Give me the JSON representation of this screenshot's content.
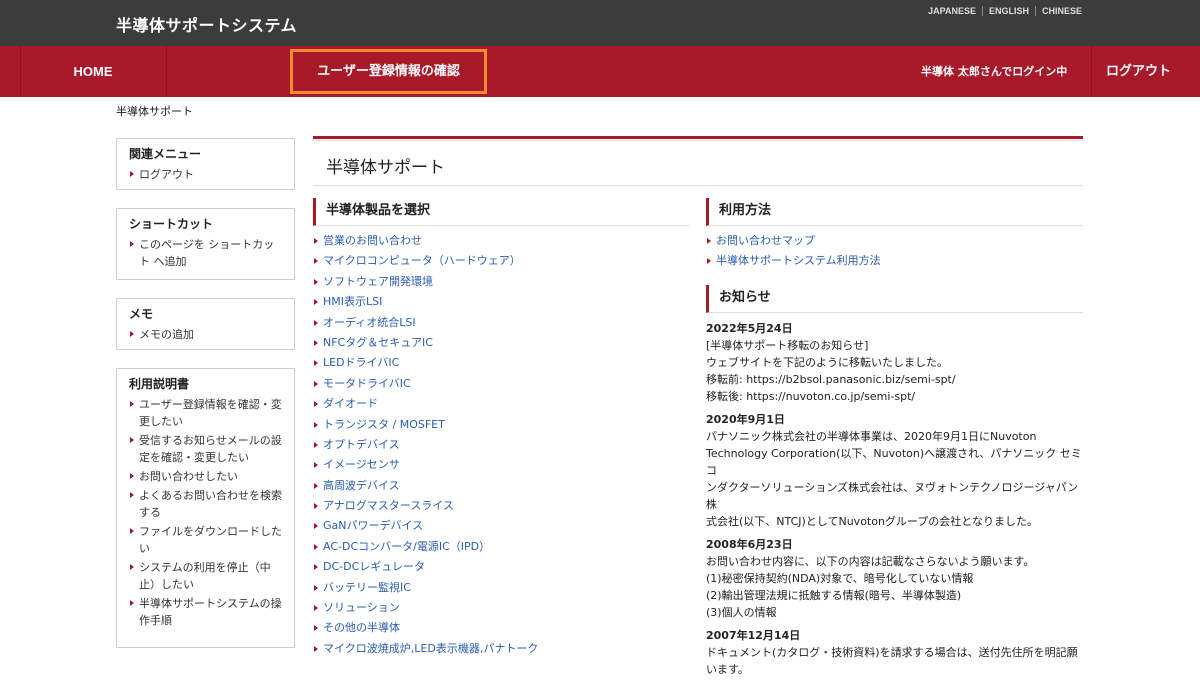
{
  "header": {
    "site_title": "半導体サポートシステム",
    "languages": [
      "JAPANESE",
      "ENGLISH",
      "CHINESE"
    ]
  },
  "nav": {
    "home": "HOME",
    "confirm": "ユーザー登録情報の確認",
    "login_message": "半導体 太郎さんでログイン中",
    "logout": "ログアウト"
  },
  "breadcrumb": "半導体サポート",
  "sidebar": {
    "related": {
      "title": "関連メニュー",
      "items": [
        "ログアウト"
      ]
    },
    "shortcut": {
      "title": "ショートカット",
      "items": [
        "このページを ショートカット へ追加"
      ]
    },
    "memo": {
      "title": "メモ",
      "items": [
        "メモの追加"
      ]
    },
    "manual": {
      "title": "利用説明書",
      "items": [
        "ユーザー登録情報を確認・変更したい",
        "受信するお知らせメールの設定を確認・変更したい",
        "お問い合わせしたい",
        "よくあるお問い合わせを検索する",
        "ファイルをダウンロードしたい",
        "システムの利用を停止（中止）したい",
        "半導体サポートシステムの操作手順"
      ]
    }
  },
  "main": {
    "page_title": "半導体サポート",
    "products": {
      "title": "半導体製品を選択",
      "items": [
        "営業のお問い合わせ",
        "マイクロコンピュータ（ハードウェア）",
        "ソフトウェア開発環境",
        "HMI表示LSI",
        "オーディオ統合LSI",
        "NFCタグ＆セキュアIC",
        "LEDドライバIC",
        "モータドライバIC",
        "ダイオード",
        "トランジスタ / MOSFET",
        "オプトデバイス",
        "イメージセンサ",
        "高周波デバイス",
        "アナログマスタースライス",
        "GaNパワーデバイス",
        "AC-DCコンバータ/電源IC（IPD）",
        "DC-DCレギュレータ",
        "バッテリー監視IC",
        "ソリューション",
        "その他の半導体",
        "マイクロ波焼成炉,LED表示機器,パナトーク"
      ]
    },
    "usage": {
      "title": "利用方法",
      "items": [
        "お問い合わせマップ",
        "半導体サポートシステム利用方法"
      ]
    },
    "news": {
      "title": "お知らせ",
      "entries": [
        {
          "date": "2022年5月24日",
          "lines": [
            "[半導体サポート移転のお知らせ]",
            "ウェブサイトを下記のように移転いたしました。",
            "移転前:  https://b2bsol.panasonic.biz/semi-spt/",
            "移転後:  https://nuvoton.co.jp/semi-spt/"
          ]
        },
        {
          "date": "2020年9月1日",
          "lines": [
            "パナソニック株式会社の半導体事業は、2020年9月1日にNuvoton",
            "Technology Corporation(以下、Nuvoton)へ譲渡され、パナソニック セミコ",
            "ンダクターソリューションズ株式会社は、ヌヴォトンテクノロジージャパン株",
            "式会社(以下、NTCJ)としてNuvotonグループの会社となりました。"
          ]
        },
        {
          "date": "2008年6月23日",
          "lines": [
            "お問い合わせ内容に、以下の内容は記載なさらないよう願います。",
            "(1)秘密保持契約(NDA)対象で、暗号化していない情報",
            "(2)輸出管理法規に抵触する情報(暗号、半導体製造)",
            "(3)個人の情報"
          ]
        },
        {
          "date": "2007年12月14日",
          "lines": [
            "ドキュメント(カタログ・技術資料)を請求する場合は、送付先住所を明記願",
            "います。"
          ]
        }
      ]
    }
  },
  "colors": {
    "brand_red": "#a8192a",
    "header_dark": "#3c3c3c",
    "highlight_orange": "#f08c2a",
    "link_blue": "#2a5db0"
  }
}
